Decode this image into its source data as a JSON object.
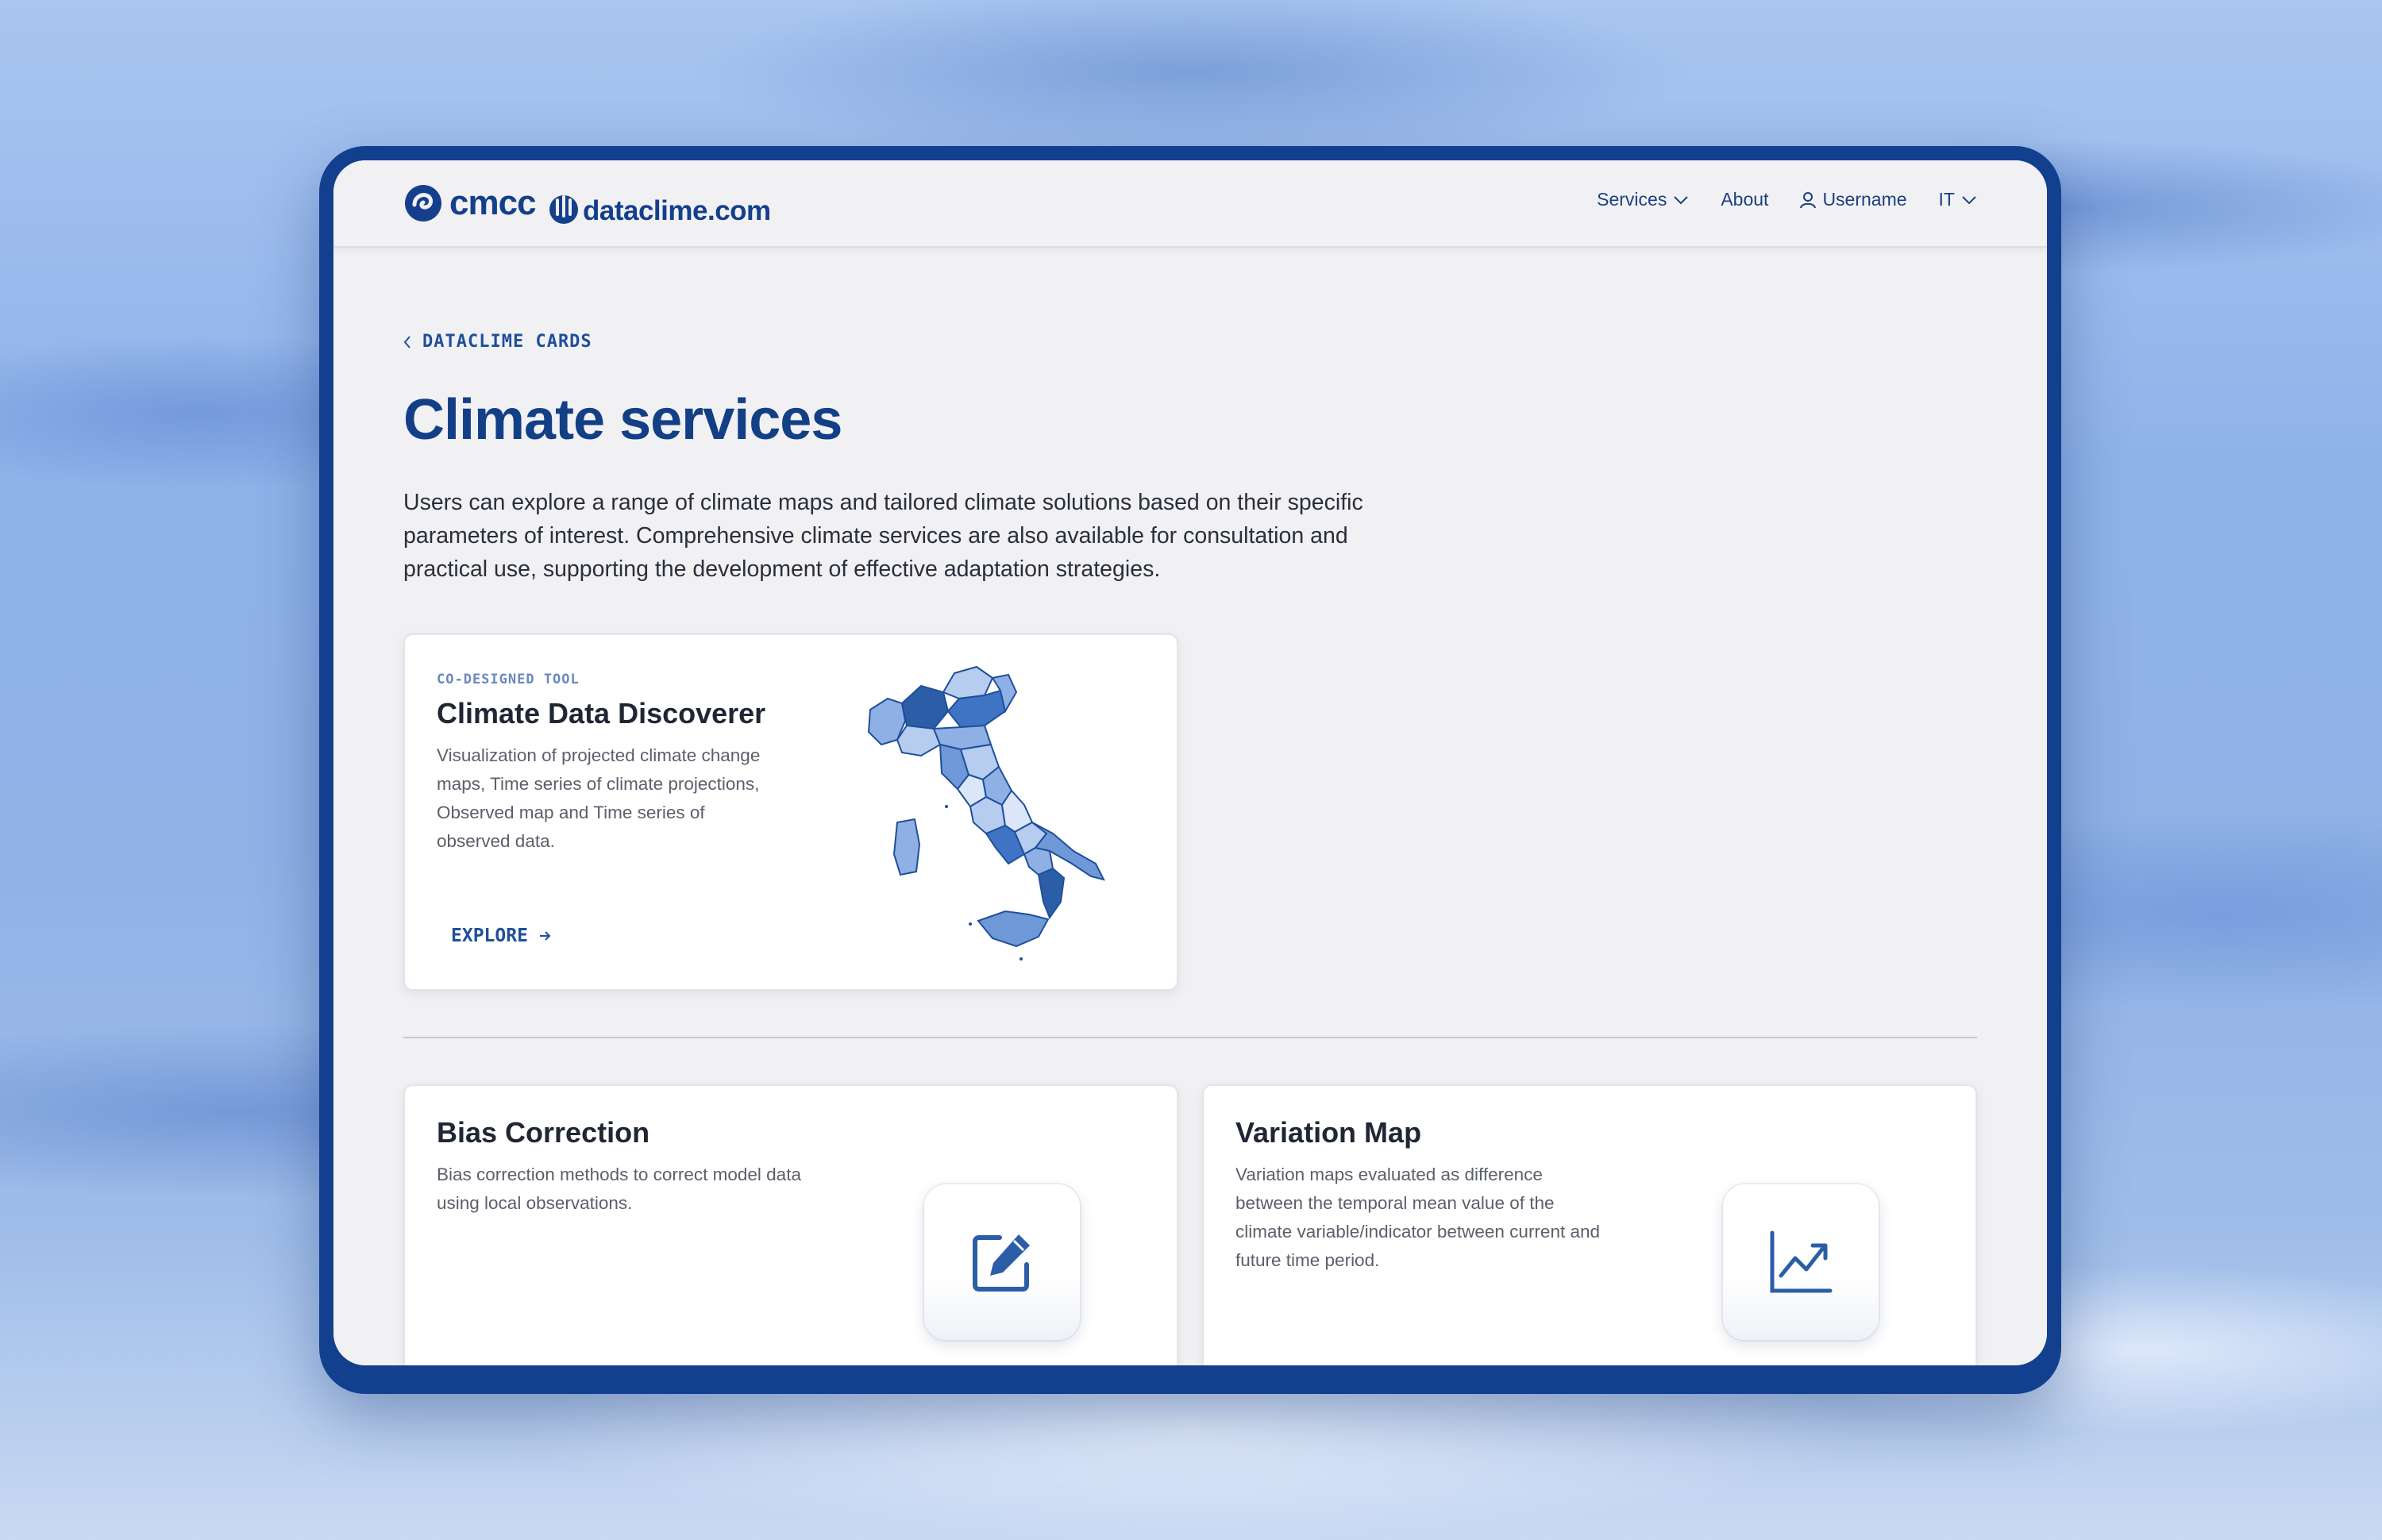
{
  "brand": {
    "primary_logo": "cmcc",
    "secondary_logo": "dataclime.com",
    "primary_color": "#133f87",
    "accent_color": "#1f4f9b",
    "frame_color": "#12408f"
  },
  "nav": {
    "services": "Services",
    "about": "About",
    "username": "Username",
    "language": "IT"
  },
  "breadcrumb": "DATACLIME CARDS",
  "page": {
    "title": "Climate services",
    "intro": "Users can explore a range of climate maps and tailored climate solutions based on their specific parameters of interest. Comprehensive climate services are also available for consultation and practical use, supporting the development of effective adaptation strategies."
  },
  "featured_card": {
    "eyebrow": "CO-DESIGNED TOOL",
    "title": "Climate Data Discoverer",
    "description": "Visualization of projected climate change maps, Time series of climate projections, Observed map and Time series of observed data.",
    "cta": "EXPLORE",
    "image_icon": "italy-map-illustration"
  },
  "cards": [
    {
      "title": "Bias Correction",
      "description": "Bias correction methods to correct model data using local observations.",
      "icon": "edit-icon"
    },
    {
      "title": "Variation Map",
      "description": "Variation maps evaluated as difference between the temporal mean value of the climate variable/indicator between current and future time period.",
      "icon": "trend-chart-icon"
    }
  ]
}
